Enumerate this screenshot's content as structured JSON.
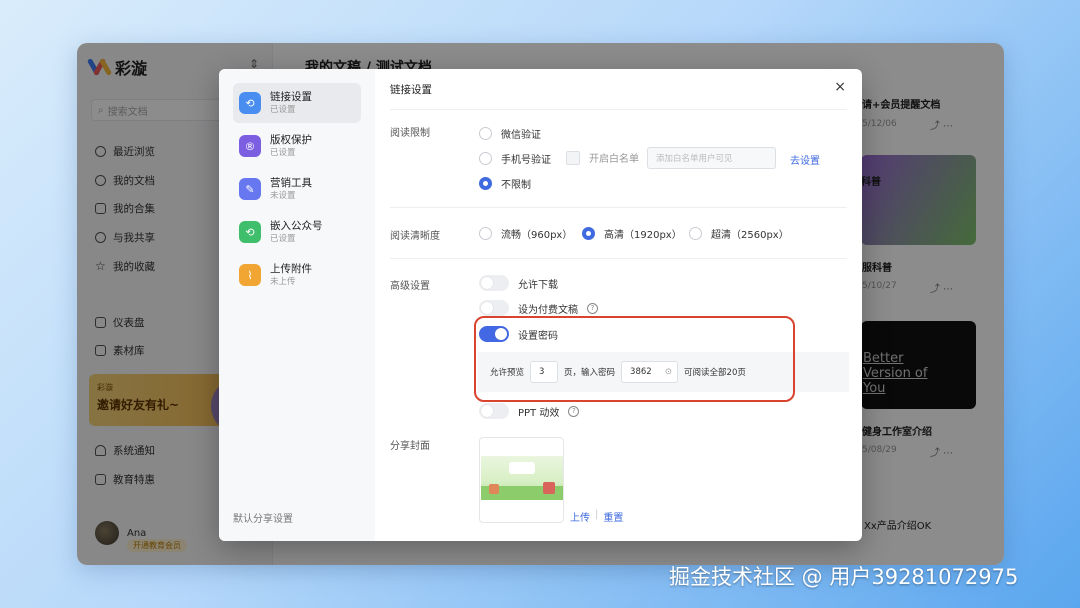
{
  "app": {
    "brand": "彩漩",
    "search_placeholder": "搜索文档",
    "nav": [
      {
        "label": "最近浏览",
        "icon": "clock-icon"
      },
      {
        "label": "我的文档",
        "icon": "person-icon"
      },
      {
        "label": "我的合集",
        "icon": "collection-icon"
      },
      {
        "label": "与我共享",
        "icon": "share-icon"
      },
      {
        "label": "我的收藏",
        "icon": "star-icon"
      }
    ],
    "nav2": [
      {
        "label": "仪表盘",
        "icon": "dashboard-icon"
      },
      {
        "label": "素材库",
        "icon": "library-icon"
      }
    ],
    "banner": {
      "small": "彩漩",
      "title": "邀请好友有礼~"
    },
    "nav3": [
      {
        "label": "系统通知",
        "icon": "bell-icon"
      },
      {
        "label": "教育特惠",
        "icon": "education-icon"
      }
    ],
    "user": {
      "name": "Ana",
      "badge": "开通教育会员"
    },
    "breadcrumb": "我的文稿 / 测试文档"
  },
  "right_cards": [
    {
      "title": "请+会员提醒文档",
      "date": "5/12/06"
    },
    {
      "title": "服科普",
      "date": "5/10/27"
    },
    {
      "title": "健身工作室介绍",
      "date": "5/08/29",
      "image_text": "Better Version of You"
    },
    {
      "title": "Xx产品介绍OK"
    }
  ],
  "modal": {
    "title": "链接设置",
    "close": "×",
    "menu": [
      {
        "label": "链接设置",
        "status": "已设置",
        "color": "#4a8df0",
        "glyph": "⟲"
      },
      {
        "label": "版权保护",
        "status": "已设置",
        "color": "#7b5fe0",
        "glyph": "®"
      },
      {
        "label": "营销工具",
        "status": "未设置",
        "color": "#6677f0",
        "glyph": "✎"
      },
      {
        "label": "嵌入公众号",
        "status": "已设置",
        "color": "#3fbf6b",
        "glyph": "⟲"
      },
      {
        "label": "上传附件",
        "status": "未上传",
        "color": "#f1a532",
        "glyph": "⌇"
      }
    ],
    "footer": "默认分享设置",
    "read_limit": {
      "label": "阅读限制",
      "options": [
        "微信验证",
        "手机号验证",
        "不限制"
      ],
      "selected": "不限制",
      "whitelist_label": "开启白名单",
      "whitelist_placeholder": "添加白名单用户可见",
      "go_settings": "去设置"
    },
    "clarity": {
      "label": "阅读清晰度",
      "options": [
        "流畅（960px）",
        "高清（1920px）",
        "超清（2560px）"
      ],
      "selected": "高清（1920px）"
    },
    "advanced": {
      "label": "高级设置",
      "allow_download": "允许下载",
      "paid_doc": "设为付费文稿",
      "set_password": "设置密码",
      "ppt_anim": "PPT 动效",
      "preview_prefix": "允许预览",
      "preview_pages": "3",
      "preview_mid": "页，输入密码",
      "password": "3862",
      "preview_suffix": "可阅读全部20页"
    },
    "cover": {
      "label": "分享封面",
      "upload": "上传",
      "divider": "|",
      "reset": "重置"
    }
  },
  "watermark": "掘金技术社区 @ 用户39281072975"
}
